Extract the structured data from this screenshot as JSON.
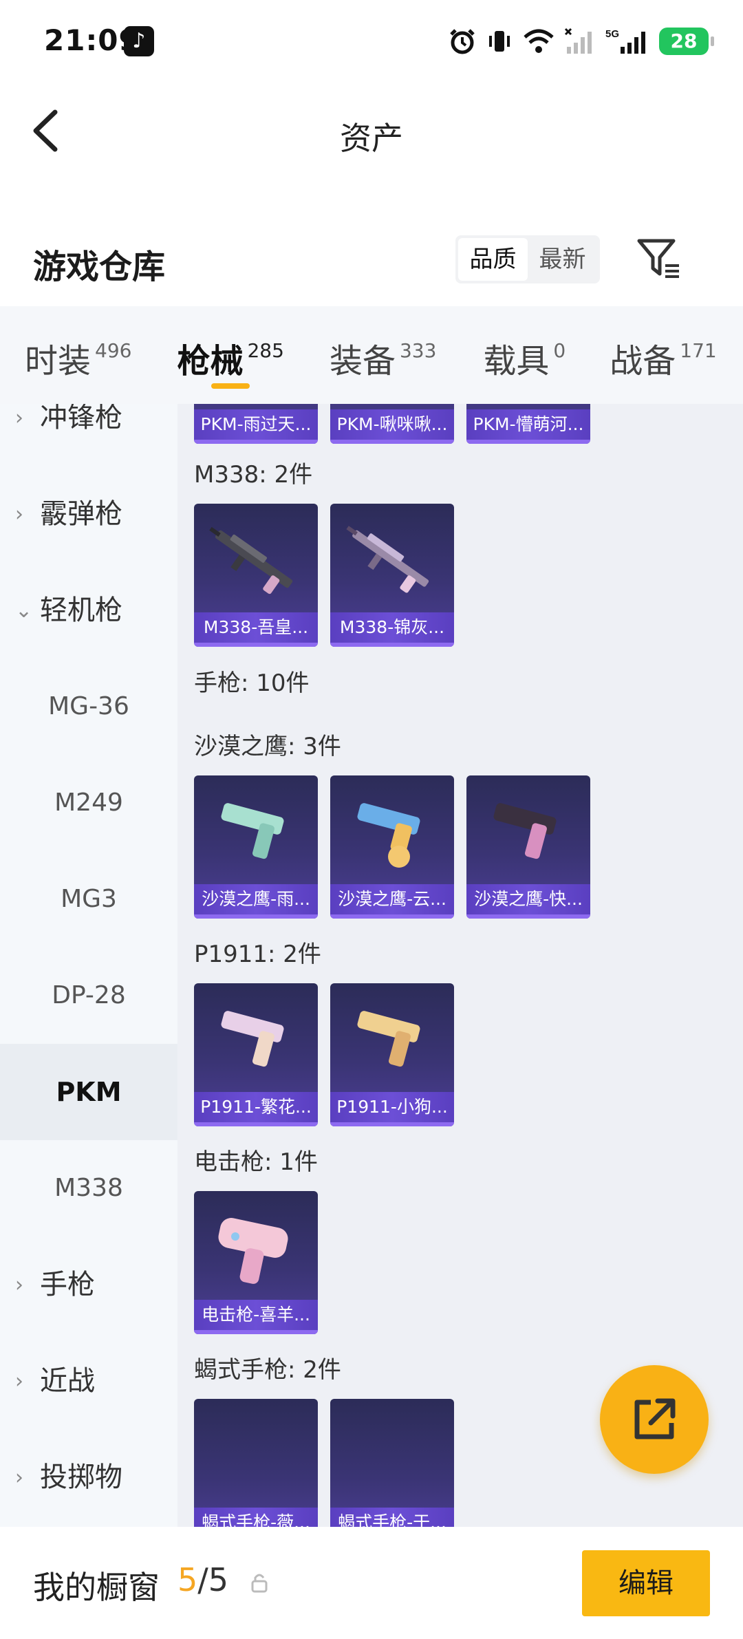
{
  "status_bar": {
    "time": "21:09",
    "battery": "28"
  },
  "nav": {
    "title": "资产"
  },
  "header": {
    "title": "游戏仓库",
    "sort_options": [
      "品质",
      "最新"
    ],
    "sort_selected": "品质"
  },
  "tabs": [
    {
      "label": "时装",
      "count": "496"
    },
    {
      "label": "枪械",
      "count": "285",
      "active": true
    },
    {
      "label": "装备",
      "count": "333"
    },
    {
      "label": "载具",
      "count": "0"
    },
    {
      "label": "战备",
      "count": "171"
    }
  ],
  "sidebar": {
    "items": [
      {
        "label": "冲锋枪",
        "type": "group",
        "expanded": false
      },
      {
        "label": "霰弹枪",
        "type": "group",
        "expanded": false
      },
      {
        "label": "轻机枪",
        "type": "group",
        "expanded": true
      },
      {
        "label": "MG-36",
        "type": "sub"
      },
      {
        "label": "M249",
        "type": "sub"
      },
      {
        "label": "MG3",
        "type": "sub"
      },
      {
        "label": "DP-28",
        "type": "sub"
      },
      {
        "label": "PKM",
        "type": "sub",
        "selected": true
      },
      {
        "label": "M338",
        "type": "sub"
      },
      {
        "label": "手枪",
        "type": "group",
        "expanded": false
      },
      {
        "label": "近战",
        "type": "group",
        "expanded": false
      },
      {
        "label": "投掷物",
        "type": "group",
        "expanded": false
      }
    ]
  },
  "content": {
    "pkm_cards": [
      "PKM-雨过天...",
      "PKM-啾咪啾...",
      "PKM-懵萌河..."
    ],
    "sections": [
      {
        "title": "M338: 2件",
        "cards": [
          "M338-吾皇...",
          "M338-锦灰..."
        ]
      },
      {
        "title": "手枪: 10件",
        "cards": []
      },
      {
        "title": "沙漠之鹰: 3件",
        "cards": [
          "沙漠之鹰-雨...",
          "沙漠之鹰-云...",
          "沙漠之鹰-快..."
        ]
      },
      {
        "title": "P1911: 2件",
        "cards": [
          "P1911-繁花...",
          "P1911-小狗..."
        ]
      },
      {
        "title": "电击枪: 1件",
        "cards": [
          "电击枪-喜羊..."
        ]
      },
      {
        "title": "蝎式手枪: 2件",
        "cards": [
          "蝎式手枪-薇...",
          "蝎式手枪-于..."
        ]
      }
    ]
  },
  "bottom": {
    "showcase_label": "我的橱窗",
    "showcase_current": "5",
    "showcase_separator": "/",
    "showcase_total": "5",
    "edit_label": "编辑"
  },
  "colors": {
    "accent": "#f9b115",
    "card_label": "#6c4fd6",
    "page_bg": "#eef0f5"
  }
}
